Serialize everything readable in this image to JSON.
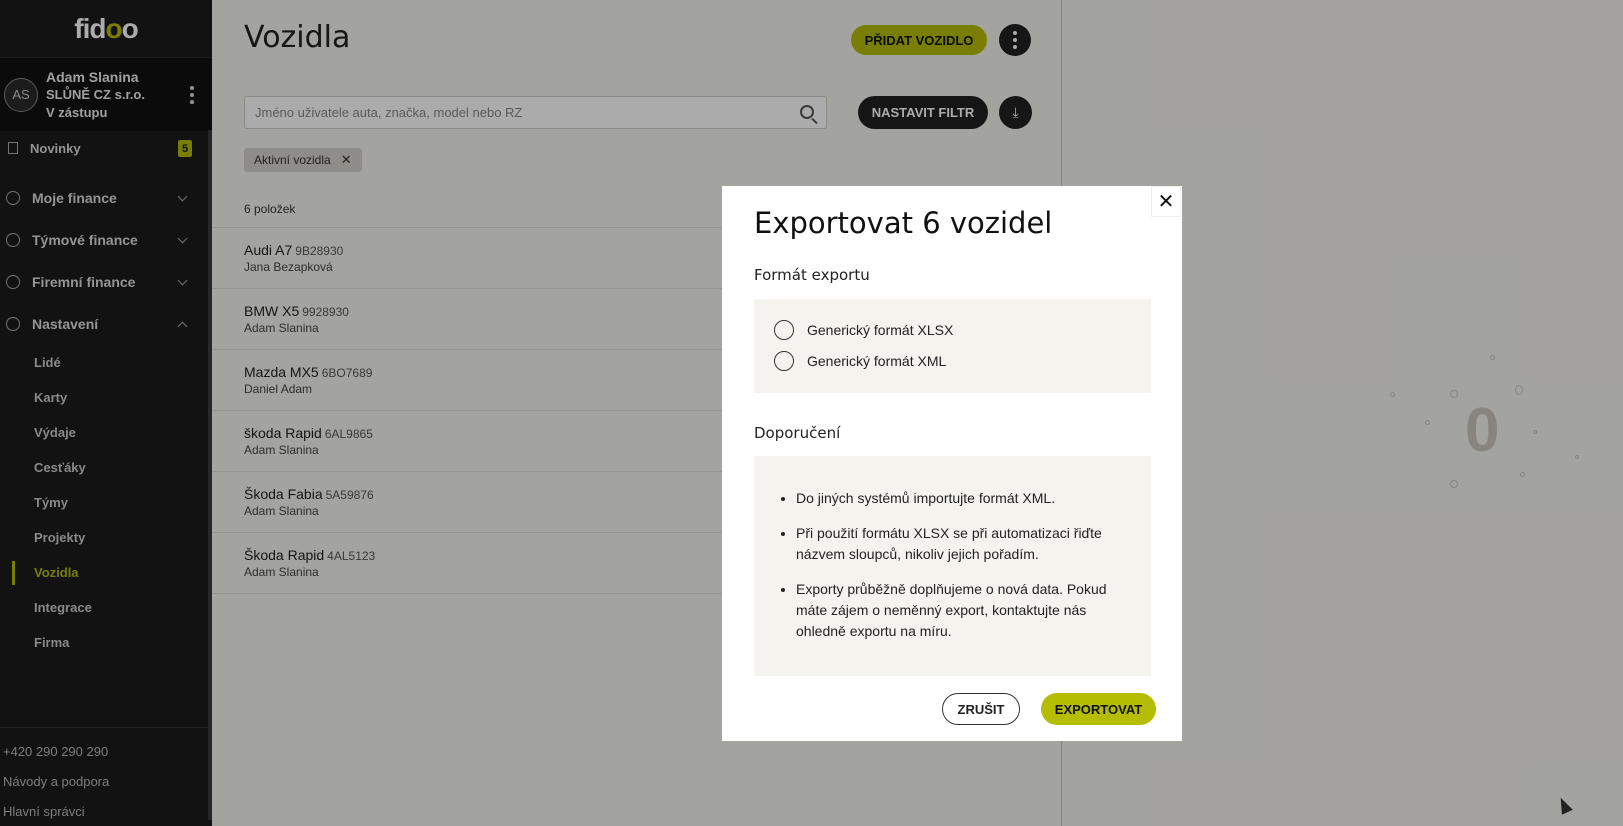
{
  "logo": {
    "part1": "fid",
    "part2": "o",
    "part3": "o"
  },
  "user": {
    "initials": "AS",
    "name": "Adam Slanina",
    "company": "SLŮNĚ CZ s.r.o.",
    "role": "V zástupu"
  },
  "news": {
    "label": "Novinky",
    "count": "5"
  },
  "nav": {
    "sections": [
      {
        "label": "Moje finance"
      },
      {
        "label": "Týmové finance"
      },
      {
        "label": "Firemní finance"
      },
      {
        "label": "Nastavení"
      }
    ],
    "settings_items": [
      "Lidé",
      "Karty",
      "Výdaje",
      "Cesťáky",
      "Týmy",
      "Projekty",
      "Vozidla",
      "Integrace",
      "Firma"
    ]
  },
  "footer": {
    "phone": "+420 290 290 290",
    "help": "Návody a podpora",
    "admins": "Hlavní správci"
  },
  "main": {
    "title": "Vozidla",
    "add_button": "PŘIDAT VOZIDLO",
    "search_placeholder": "Jméno uživatele auta, značka, model nebo RZ",
    "filter_button": "NASTAVIT FILTR",
    "chip": "Aktivní vozidla",
    "count": "6 položek",
    "vehicles": [
      {
        "model": "Audi A7",
        "plate": "9B28930",
        "user": "Jana Bezapková"
      },
      {
        "model": "BMW X5",
        "plate": "9928930",
        "user": "Adam Slanina"
      },
      {
        "model": "Mazda MX5",
        "plate": "6BO7689",
        "user": "Daniel Adam"
      },
      {
        "model": "škoda Rapid",
        "plate": "6AL9865",
        "user": "Adam Slanina"
      },
      {
        "model": "Škoda Fabia",
        "plate": "5A59876",
        "user": "Adam Slanina"
      },
      {
        "model": "Škoda Rapid",
        "plate": "4AL5123",
        "user": "Adam Slanina"
      }
    ]
  },
  "right": {
    "zero": "0"
  },
  "modal": {
    "title": "Exportovat 6 vozidel",
    "format_heading": "Formát exportu",
    "options": [
      "Generický formát XLSX",
      "Generický formát XML"
    ],
    "rec_heading": "Doporučení",
    "recommendations": [
      "Do jiných systémů importujte formát XML.",
      "Při použití formátu XLSX se při automatizaci řiďte názvem sloupců, nikoliv jejich pořadím.",
      "Exporty průběžně doplňujeme o nová data. Pokud máte zájem o neměnný export, kontaktujte nás ohledně exportu na míru."
    ],
    "cancel": "ZRUŠIT",
    "export": "EXPORTOVAT"
  },
  "colors": {
    "accent": "#b5bd00",
    "sidebar": "#1c1c1c"
  }
}
